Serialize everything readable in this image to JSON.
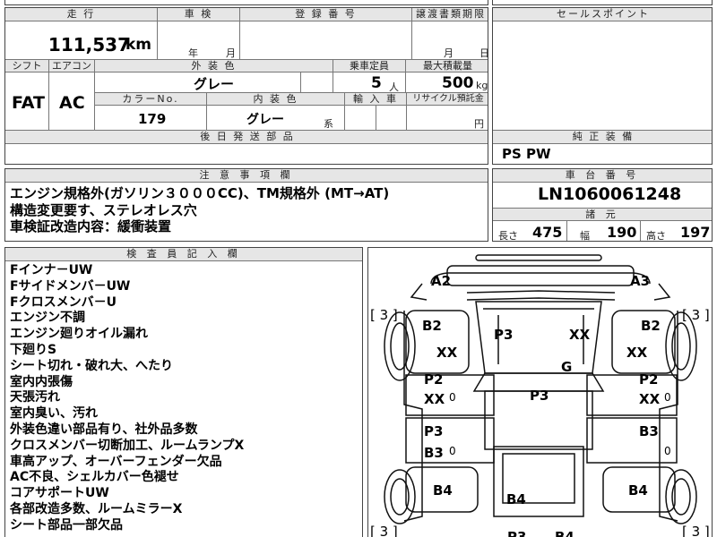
{
  "top_row": {
    "col1": "",
    "col2": "",
    "col3": "",
    "col4": ""
  },
  "mileage": {
    "header": "走 行",
    "value": "111,537",
    "unit": "km"
  },
  "inspection": {
    "header": "車 検",
    "year_label": "年",
    "month_label": "月"
  },
  "registration": {
    "header": "登 録 番 号"
  },
  "transfer_deadline": {
    "header": "譲渡書類期限",
    "month_label": "月",
    "day_label": "日"
  },
  "sales_points": {
    "header": "セールスポイント"
  },
  "shift": {
    "header": "シフト",
    "value": "FAT"
  },
  "aircon": {
    "header": "エアコン",
    "value": "AC"
  },
  "exterior_color": {
    "header": "外 装 色",
    "value": "グレー"
  },
  "capacity": {
    "header": "乗車定員",
    "value": "5",
    "unit": "人"
  },
  "max_load": {
    "header": "最大積載量",
    "value": "500",
    "unit": "kg"
  },
  "color_no": {
    "header": "カラーNo.",
    "value": "179"
  },
  "interior_color": {
    "header": "内 装 色",
    "value": "グレー",
    "suffix": "系"
  },
  "import": {
    "header": "輸 入 車"
  },
  "recycle": {
    "header": "リサイクル預託金",
    "unit": "円"
  },
  "later_parts": {
    "header": "後 日 発 送 部 品"
  },
  "genuine_equipment": {
    "header": "純 正 装 備",
    "value": "PS PW"
  },
  "notes": {
    "header": "注 意 事 項 欄",
    "lines": [
      "エンジン規格外(ガソリン３０００CC)、TM規格外 (MT→AT)",
      "構造変更要す、ステレオレス穴",
      "車検証改造内容：緩衝装置"
    ]
  },
  "chassis": {
    "header": "車 台 番 号",
    "value": "LN1060061248"
  },
  "dimensions": {
    "header": "諸 元",
    "length_label": "長さ",
    "length": "475",
    "width_label": "幅",
    "width": "190",
    "height_label": "高さ",
    "height": "197"
  },
  "inspector": {
    "header": "検 査 員 記 入 欄",
    "lines": [
      "Fインナ－UW",
      "Fサイドメンバ－UW",
      "Fクロスメンバ－U",
      "エンジン不調",
      "エンジン廻りオイル漏れ",
      "下廻りS",
      "シート切れ・破れ大、へたり",
      "室内内張傷",
      "天張汚れ",
      "室内臭い、汚れ",
      "外装色違い部品有り、社外品多数",
      "クロスメンバー切断加工、ルームランプX",
      "車高アップ、オーバーフェンダー欠品",
      "AC不良、シェルカバー色褪せ",
      "コアサポートUW",
      "各部改造多数、ルームミラーX",
      "シート部品一部欠品"
    ]
  },
  "diagram": {
    "marks": {
      "front_left": "A2",
      "front_right": "A3",
      "tire_tl": "[ 3 ]",
      "tire_tr": "[ 3 ]",
      "tire_bl": "[ 3 ]",
      "tire_br": "[ 3 ]",
      "fender_l_b": "B2",
      "fender_l_xx": "XX",
      "fender_r_b": "B2",
      "fender_r_xx": "XX",
      "hood_p": "P3",
      "hood_xx": "XX",
      "glass": "G",
      "door_fl_p": "P2",
      "door_fl_xx": "XX",
      "door_fl_o": "0",
      "door_fr_p": "P2",
      "door_fr_xx": "XX",
      "door_fr_o": "0",
      "roof": "P3",
      "door_rl_p": "P3",
      "door_rl_b": "B3",
      "door_rl_o": "0",
      "door_rr_b": "B3",
      "door_rr_o": "0",
      "quarter_l": "B4",
      "quarter_r": "B4",
      "rear_center": "B4",
      "bottom_p": "P3",
      "bottom_b": "B4"
    }
  }
}
